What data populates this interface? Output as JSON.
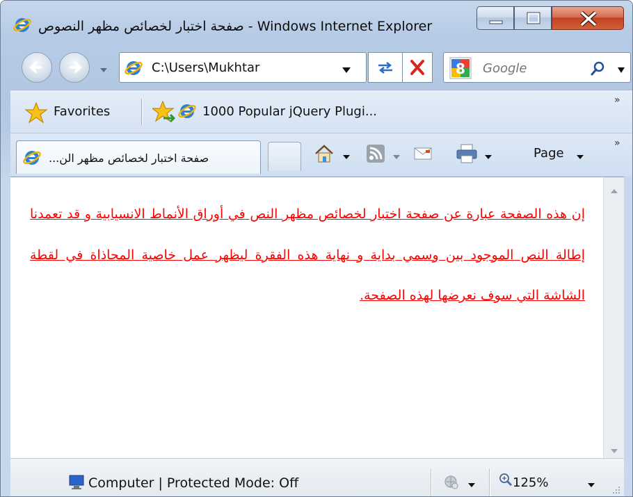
{
  "window": {
    "title": "صفحة اختبار لخصائص مظهر النصوص - Windows Internet Explorer"
  },
  "address_bar": {
    "url": "C:\\Users\\Mukhtar"
  },
  "search": {
    "placeholder": "Google"
  },
  "favorites_bar": {
    "favorites_label": "Favorites",
    "link_label": "1000 Popular jQuery Plugi...",
    "overflow": "»"
  },
  "tabs": [
    {
      "label": "...صفحة اختبار لخصائص مظهر الن",
      "active": true
    }
  ],
  "command_bar": {
    "page_label": "Page",
    "overflow": "»",
    "items": [
      "home-icon",
      "feeds-icon",
      "read-mail-icon",
      "print-icon"
    ]
  },
  "content": {
    "paragraph": "إن هذه الصفحة عبارة عن صفحة اختبار لخصائص مظهر النص في أوراق الأنماط الانسيابية و قد تعمدنا إطالة النص الموجود بين وسمي بداية و نهاية هذه الفقرة ليظهر عمل خاصية المحاذاة في لقطة الشاشة التي سوف نعرضها لهذه الصفحة.",
    "text_color": "#ff0000"
  },
  "status_bar": {
    "zone_text": "Computer | Protected Mode: Off",
    "zoom": "125%"
  },
  "colors": {
    "frame": "#b9cce6",
    "close_button": "#c14420"
  }
}
